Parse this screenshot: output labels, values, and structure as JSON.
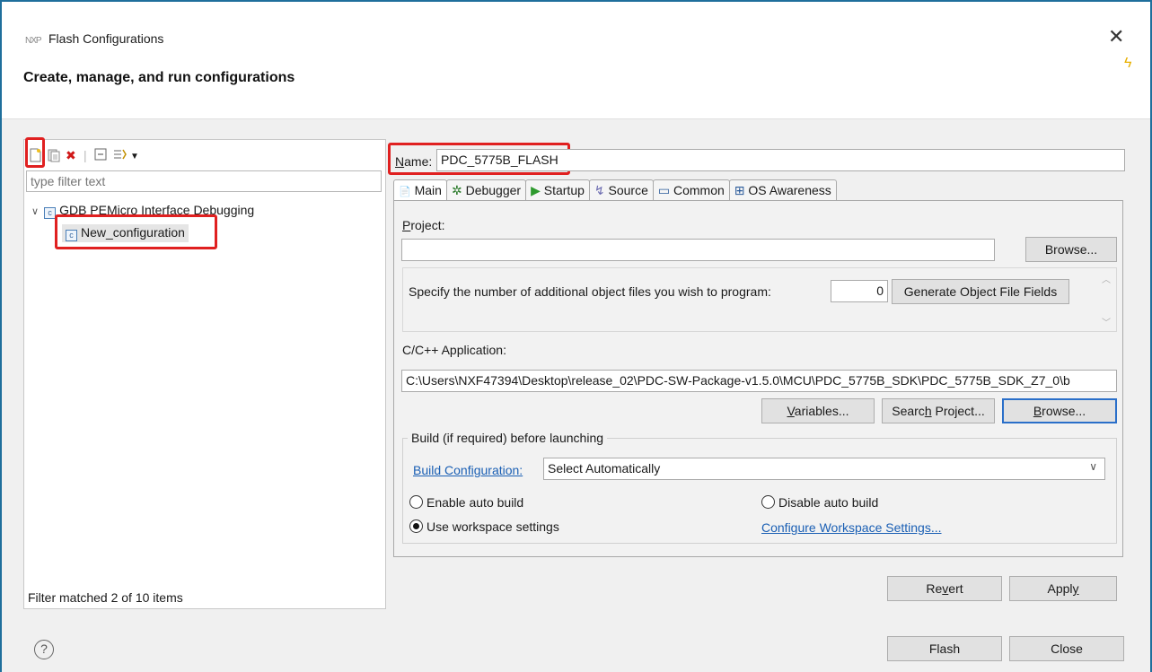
{
  "window": {
    "logo_text": "NXP",
    "title": "Flash Configurations",
    "close_glyph": "✕",
    "bolt_glyph": "ϟ",
    "headline": "Create, manage, and run configurations"
  },
  "left": {
    "toolbar_icons": [
      "new-config-icon",
      "duplicate-icon",
      "delete-icon",
      "collapse-icon",
      "filter-icon",
      "dropdown-icon"
    ],
    "filter_placeholder": "type filter text",
    "tree": {
      "group_label": "GDB PEMicro Interface Debugging",
      "item_label": "New_configuration",
      "icon_letter": "c"
    },
    "status": "Filter matched 2 of 10 items"
  },
  "right": {
    "name_label": "Name:",
    "name_value": "PDC_5775B_FLASH",
    "tabs": [
      {
        "icon": "📄",
        "label": "Main"
      },
      {
        "icon": "✲",
        "label": "Debugger"
      },
      {
        "icon": "▶",
        "label": "Startup"
      },
      {
        "icon": "↯",
        "label": "Source"
      },
      {
        "icon": "▭",
        "label": "Common"
      },
      {
        "icon": "⊞",
        "label": "OS Awareness"
      }
    ],
    "project_label": "Project:",
    "project_value": "",
    "browse_label": "Browse...",
    "objfiles_label": "Specify the number of additional object files you wish to program:",
    "objfiles_count": "0",
    "gen_fields_label": "Generate Object File Fields",
    "app_label": "C/C++ Application:",
    "app_value": "C:\\Users\\NXF47394\\Desktop\\release_02\\PDC-SW-Package-v1.5.0\\MCU\\PDC_5775B_SDK\\PDC_5775B_SDK_Z7_0\\b",
    "variables_label": "Variables...",
    "search_project_label": "Search Project...",
    "browse2_label": "Browse...",
    "build_group_label": "Build (if required) before launching",
    "build_config_link": "Build Configuration:",
    "build_config_value": "Select Automatically",
    "enable_auto_build": "Enable auto build",
    "disable_auto_build": "Disable auto build",
    "use_workspace": "Use workspace settings",
    "configure_workspace": "Configure Workspace Settings...",
    "revert_label": "Revert",
    "apply_label": "Apply"
  },
  "footer": {
    "help_glyph": "?",
    "flash_label": "Flash",
    "close_label": "Close"
  },
  "colors": {
    "highlight": "#e02020",
    "accent": "#1f6f9c",
    "link": "#1a5fb4"
  }
}
